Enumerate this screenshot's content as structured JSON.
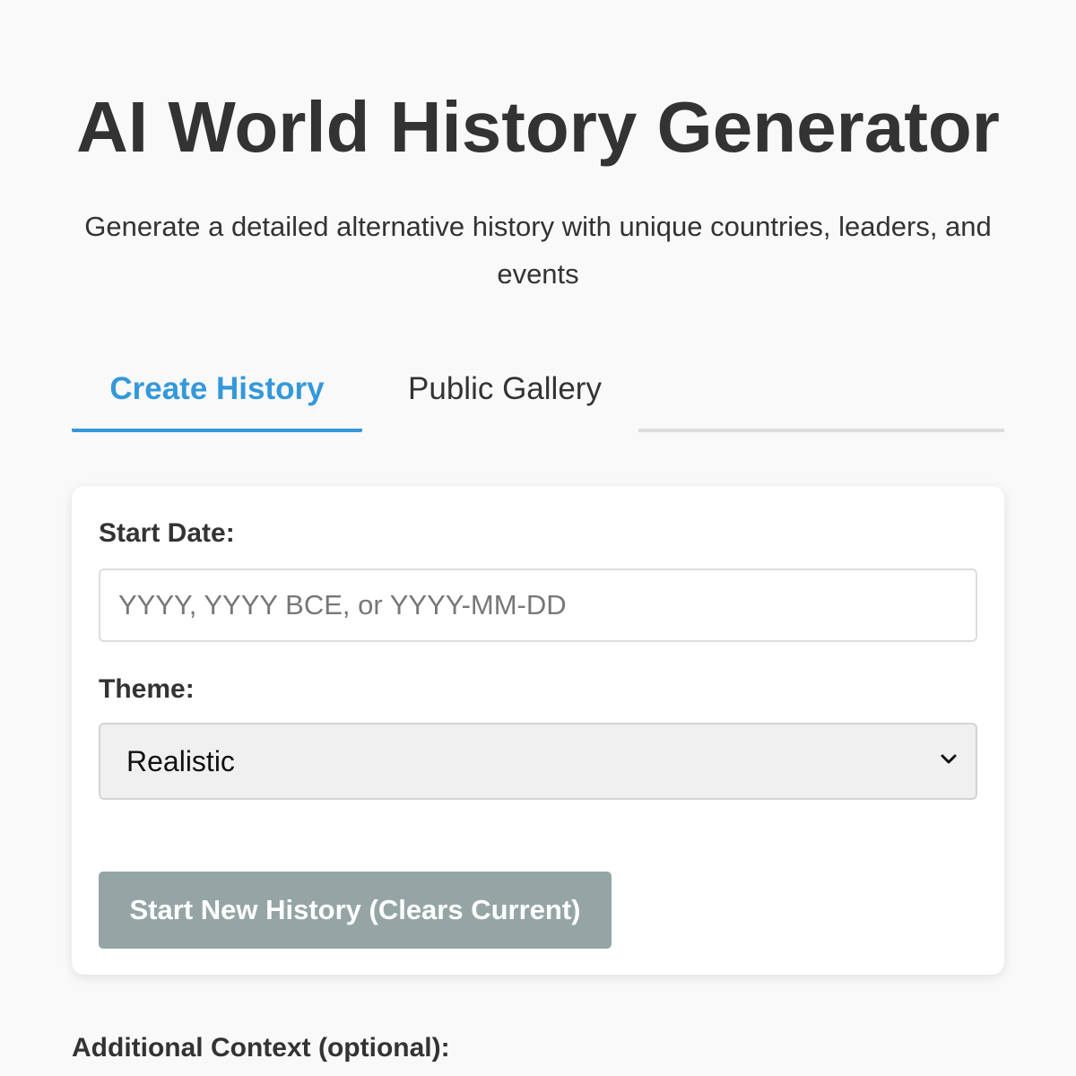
{
  "header": {
    "title": "AI World History Generator",
    "subtitle": "Generate a detailed alternative history with unique countries, leaders, and events"
  },
  "tabs": [
    {
      "label": "Create History",
      "active": true
    },
    {
      "label": "Public Gallery",
      "active": false
    }
  ],
  "form": {
    "start_date_label": "Start Date:",
    "start_date_value": "",
    "start_date_placeholder": "YYYY, YYYY BCE, or YYYY-MM-DD",
    "theme_label": "Theme:",
    "theme_selected": "Realistic",
    "start_button_label": "Start New History (Clears Current)"
  },
  "additional_context_label": "Additional Context (optional):",
  "colors": {
    "accent": "#3498db",
    "button_disabled": "#95a5a6",
    "background": "#f9f9f9",
    "text": "#333333"
  },
  "icons": {
    "theme_select": "chevron-down-icon"
  }
}
